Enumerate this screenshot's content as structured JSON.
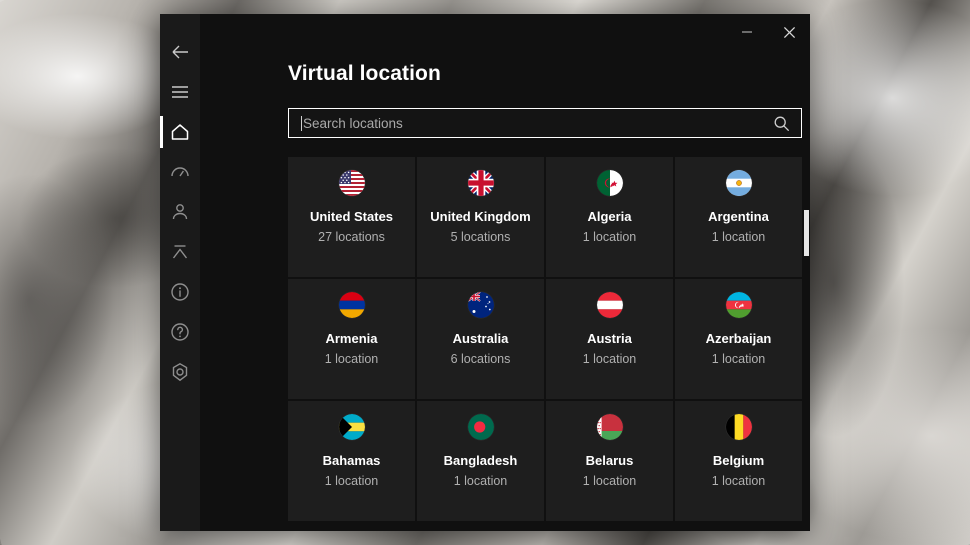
{
  "window": {
    "title_bar": {
      "minimize_label": "—",
      "close_label": "×",
      "minimize_icon": "minimize-icon",
      "close_icon": "close-icon"
    }
  },
  "sidebar": {
    "items": [
      {
        "icon": "back-arrow-icon",
        "name": "back",
        "selected": false
      },
      {
        "icon": "hamburger-menu-icon",
        "name": "menu",
        "selected": false
      },
      {
        "icon": "home-icon",
        "name": "home",
        "selected": true
      },
      {
        "icon": "speedometer-icon",
        "name": "speed-test",
        "selected": false
      },
      {
        "icon": "person-icon",
        "name": "account",
        "selected": false
      },
      {
        "icon": "chevron-up-bar-icon",
        "name": "split-tunneling",
        "selected": false
      },
      {
        "icon": "info-icon",
        "name": "info",
        "selected": false
      },
      {
        "icon": "question-mark-icon",
        "name": "help",
        "selected": false
      },
      {
        "icon": "hex-gear-icon",
        "name": "settings",
        "selected": false
      }
    ]
  },
  "main": {
    "page_title": "Virtual location",
    "search": {
      "placeholder": "Search locations",
      "value": "",
      "icon": "search-icon"
    },
    "countries": [
      {
        "name": "United States",
        "count": "27 locations",
        "flag": "us"
      },
      {
        "name": "United Kingdom",
        "count": "5 locations",
        "flag": "gb"
      },
      {
        "name": "Algeria",
        "count": "1 location",
        "flag": "dz"
      },
      {
        "name": "Argentina",
        "count": "1 location",
        "flag": "ar"
      },
      {
        "name": "Armenia",
        "count": "1 location",
        "flag": "am"
      },
      {
        "name": "Australia",
        "count": "6 locations",
        "flag": "au"
      },
      {
        "name": "Austria",
        "count": "1 location",
        "flag": "at"
      },
      {
        "name": "Azerbaijan",
        "count": "1 location",
        "flag": "az"
      },
      {
        "name": "Bahamas",
        "count": "1 location",
        "flag": "bs"
      },
      {
        "name": "Bangladesh",
        "count": "1 location",
        "flag": "bd"
      },
      {
        "name": "Belarus",
        "count": "1 location",
        "flag": "by"
      },
      {
        "name": "Belgium",
        "count": "1 location",
        "flag": "be"
      }
    ]
  },
  "colors": {
    "window_bg": "#101010",
    "sidebar_bg": "#1a1a1a",
    "card_bg": "#1e1e1e",
    "accent": "#ffffff",
    "text_primary": "#ffffff",
    "text_secondary": "#b0b0b0"
  }
}
